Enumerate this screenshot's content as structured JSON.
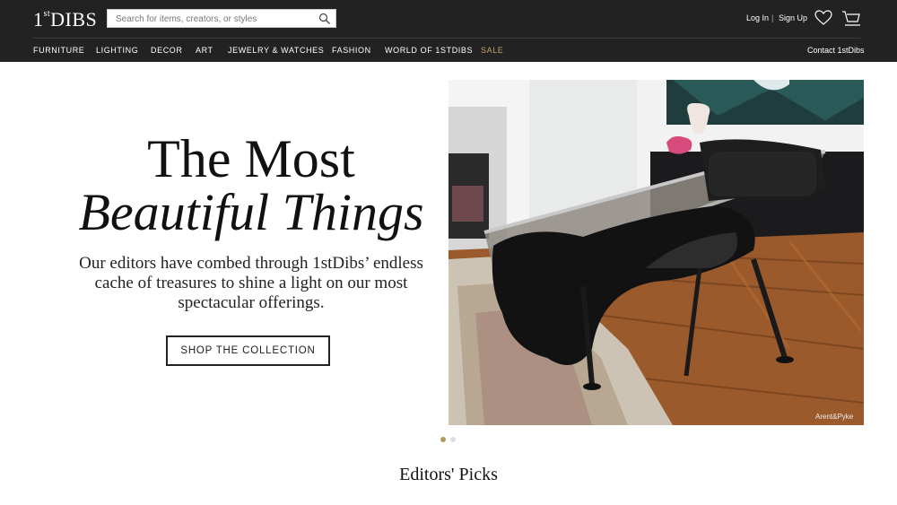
{
  "header": {
    "logo_main": "DIBS",
    "logo_prefix": "1",
    "logo_sup": "st",
    "search_placeholder": "Search for items, creators, or styles",
    "login": "Log In",
    "separator": "|",
    "signup": "Sign Up"
  },
  "nav": {
    "items": [
      "FURNITURE",
      "LIGHTING",
      "DECOR",
      "ART",
      "JEWELRY & WATCHES",
      "FASHION",
      "WORLD OF 1STDIBS",
      "SALE"
    ],
    "contact": "Contact 1stDibs"
  },
  "hero": {
    "title_line1": "The Most",
    "title_line2": "Beautiful Things",
    "subtitle": "Our editors have combed through 1stDibs’ endless cache of treasures to shine a light on our most spectacular offerings.",
    "button": "SHOP THE COLLECTION",
    "image_credit": "Arent&Pyke",
    "carousel_active": 1,
    "carousel_total": 2
  },
  "section": {
    "title": "Editors' Picks"
  },
  "colors": {
    "header_bg": "#222222",
    "sale": "#c4a268",
    "dot_active": "#b09a5a",
    "dot_inactive": "#dddddd"
  }
}
